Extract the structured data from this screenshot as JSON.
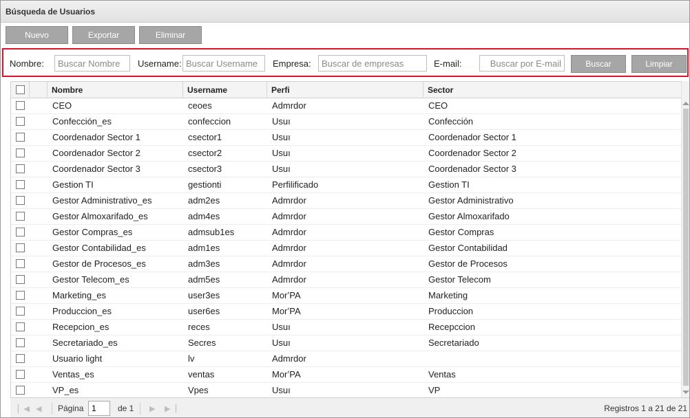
{
  "window": {
    "title": "Búsqueda de Usuarios"
  },
  "toolbar": {
    "new_label": "Nuevo",
    "export_label": "Exportar",
    "delete_label": "Eliminar"
  },
  "filters": {
    "nombre_label": "Nombre:",
    "nombre_placeholder": "Buscar Nombre",
    "username_label": "Username:",
    "username_placeholder": "Buscar Username",
    "empresa_label": "Empresa:",
    "empresa_placeholder": "Buscar de empresas",
    "email_label": "E-mail:",
    "email_placeholder": "Buscar por E-mail",
    "search_label": "Buscar",
    "clear_label": "Limpiar"
  },
  "grid": {
    "headers": {
      "nombre": "Nombre",
      "username": "Username",
      "perfil": "Perfi",
      "sector": "Sector"
    },
    "rows": [
      {
        "nombre": "CEO",
        "username": "ceoes",
        "perfil": "Admrdor",
        "sector": "CEO"
      },
      {
        "nombre": "Confección_es",
        "username": "confeccion",
        "perfil": "Usuı",
        "sector": "Confección"
      },
      {
        "nombre": "Coordenador Sector 1",
        "username": "csector1",
        "perfil": "Usuı",
        "sector": "Coordenador Sector 1"
      },
      {
        "nombre": "Coordenador Sector 2",
        "username": "csector2",
        "perfil": "Usuı",
        "sector": "Coordenador Sector 2"
      },
      {
        "nombre": "Coordenador Sector 3",
        "username": "csector3",
        "perfil": "Usuı",
        "sector": "Coordenador Sector 3"
      },
      {
        "nombre": "Gestion TI",
        "username": "gestionti",
        "perfil": "Perfilificado",
        "sector": "Gestion TI"
      },
      {
        "nombre": "Gestor Administrativo_es",
        "username": "adm2es",
        "perfil": "Admrdor",
        "sector": "Gestor Administrativo"
      },
      {
        "nombre": "Gestor Almoxarifado_es",
        "username": "adm4es",
        "perfil": "Admrdor",
        "sector": "Gestor Almoxarifado"
      },
      {
        "nombre": "Gestor Compras_es",
        "username": "admsub1es",
        "perfil": "Admrdor",
        "sector": "Gestor Compras"
      },
      {
        "nombre": "Gestor Contabilidad_es",
        "username": "adm1es",
        "perfil": "Admrdor",
        "sector": "Gestor Contabilidad"
      },
      {
        "nombre": "Gestor de Procesos_es",
        "username": "adm3es",
        "perfil": "Admrdor",
        "sector": "Gestor de Procesos"
      },
      {
        "nombre": "Gestor Telecom_es",
        "username": "adm5es",
        "perfil": "Admrdor",
        "sector": "Gestor Telecom"
      },
      {
        "nombre": "Marketing_es",
        "username": "user3es",
        "perfil": "MorʼPA",
        "sector": "Marketing"
      },
      {
        "nombre": "Produccion_es",
        "username": "user6es",
        "perfil": "MorʼPA",
        "sector": "Produccion"
      },
      {
        "nombre": "Recepcion_es",
        "username": "reces",
        "perfil": "Usuı",
        "sector": "Recepccion"
      },
      {
        "nombre": "Secretariado_es",
        "username": "Secres",
        "perfil": "Usuı",
        "sector": "Secretariado"
      },
      {
        "nombre": "Usuario light",
        "username": "lv",
        "perfil": "Admrdor",
        "sector": ""
      },
      {
        "nombre": "Ventas_es",
        "username": "ventas",
        "perfil": "MorʼPA",
        "sector": "Ventas"
      },
      {
        "nombre": "VP_es",
        "username": "Vpes",
        "perfil": "Usuı",
        "sector": "VP"
      }
    ]
  },
  "pager": {
    "page_label": "Página",
    "page_value": "1",
    "of_label": "de 1",
    "records_label": "Registros 1 a 21 de 21"
  },
  "colors": {
    "accent_border": "#e0102a",
    "button_bg": "#a6a6a6"
  },
  "icons": [
    "first-page-icon",
    "prev-page-icon",
    "next-page-icon",
    "last-page-icon",
    "scroll-up-icon",
    "scroll-down-icon"
  ]
}
